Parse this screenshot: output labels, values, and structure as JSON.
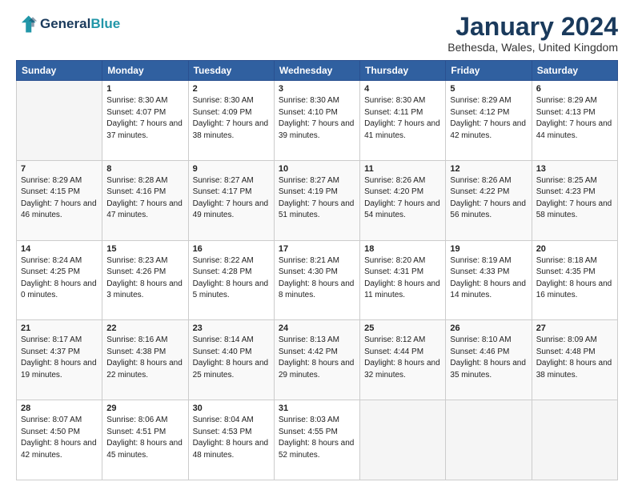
{
  "header": {
    "logo_general": "General",
    "logo_blue": "Blue",
    "month": "January 2024",
    "location": "Bethesda, Wales, United Kingdom"
  },
  "days_of_week": [
    "Sunday",
    "Monday",
    "Tuesday",
    "Wednesday",
    "Thursday",
    "Friday",
    "Saturday"
  ],
  "weeks": [
    [
      {
        "day": "",
        "sunrise": "",
        "sunset": "",
        "daylight": ""
      },
      {
        "day": "1",
        "sunrise": "Sunrise: 8:30 AM",
        "sunset": "Sunset: 4:07 PM",
        "daylight": "Daylight: 7 hours and 37 minutes."
      },
      {
        "day": "2",
        "sunrise": "Sunrise: 8:30 AM",
        "sunset": "Sunset: 4:09 PM",
        "daylight": "Daylight: 7 hours and 38 minutes."
      },
      {
        "day": "3",
        "sunrise": "Sunrise: 8:30 AM",
        "sunset": "Sunset: 4:10 PM",
        "daylight": "Daylight: 7 hours and 39 minutes."
      },
      {
        "day": "4",
        "sunrise": "Sunrise: 8:30 AM",
        "sunset": "Sunset: 4:11 PM",
        "daylight": "Daylight: 7 hours and 41 minutes."
      },
      {
        "day": "5",
        "sunrise": "Sunrise: 8:29 AM",
        "sunset": "Sunset: 4:12 PM",
        "daylight": "Daylight: 7 hours and 42 minutes."
      },
      {
        "day": "6",
        "sunrise": "Sunrise: 8:29 AM",
        "sunset": "Sunset: 4:13 PM",
        "daylight": "Daylight: 7 hours and 44 minutes."
      }
    ],
    [
      {
        "day": "7",
        "sunrise": "Sunrise: 8:29 AM",
        "sunset": "Sunset: 4:15 PM",
        "daylight": "Daylight: 7 hours and 46 minutes."
      },
      {
        "day": "8",
        "sunrise": "Sunrise: 8:28 AM",
        "sunset": "Sunset: 4:16 PM",
        "daylight": "Daylight: 7 hours and 47 minutes."
      },
      {
        "day": "9",
        "sunrise": "Sunrise: 8:27 AM",
        "sunset": "Sunset: 4:17 PM",
        "daylight": "Daylight: 7 hours and 49 minutes."
      },
      {
        "day": "10",
        "sunrise": "Sunrise: 8:27 AM",
        "sunset": "Sunset: 4:19 PM",
        "daylight": "Daylight: 7 hours and 51 minutes."
      },
      {
        "day": "11",
        "sunrise": "Sunrise: 8:26 AM",
        "sunset": "Sunset: 4:20 PM",
        "daylight": "Daylight: 7 hours and 54 minutes."
      },
      {
        "day": "12",
        "sunrise": "Sunrise: 8:26 AM",
        "sunset": "Sunset: 4:22 PM",
        "daylight": "Daylight: 7 hours and 56 minutes."
      },
      {
        "day": "13",
        "sunrise": "Sunrise: 8:25 AM",
        "sunset": "Sunset: 4:23 PM",
        "daylight": "Daylight: 7 hours and 58 minutes."
      }
    ],
    [
      {
        "day": "14",
        "sunrise": "Sunrise: 8:24 AM",
        "sunset": "Sunset: 4:25 PM",
        "daylight": "Daylight: 8 hours and 0 minutes."
      },
      {
        "day": "15",
        "sunrise": "Sunrise: 8:23 AM",
        "sunset": "Sunset: 4:26 PM",
        "daylight": "Daylight: 8 hours and 3 minutes."
      },
      {
        "day": "16",
        "sunrise": "Sunrise: 8:22 AM",
        "sunset": "Sunset: 4:28 PM",
        "daylight": "Daylight: 8 hours and 5 minutes."
      },
      {
        "day": "17",
        "sunrise": "Sunrise: 8:21 AM",
        "sunset": "Sunset: 4:30 PM",
        "daylight": "Daylight: 8 hours and 8 minutes."
      },
      {
        "day": "18",
        "sunrise": "Sunrise: 8:20 AM",
        "sunset": "Sunset: 4:31 PM",
        "daylight": "Daylight: 8 hours and 11 minutes."
      },
      {
        "day": "19",
        "sunrise": "Sunrise: 8:19 AM",
        "sunset": "Sunset: 4:33 PM",
        "daylight": "Daylight: 8 hours and 14 minutes."
      },
      {
        "day": "20",
        "sunrise": "Sunrise: 8:18 AM",
        "sunset": "Sunset: 4:35 PM",
        "daylight": "Daylight: 8 hours and 16 minutes."
      }
    ],
    [
      {
        "day": "21",
        "sunrise": "Sunrise: 8:17 AM",
        "sunset": "Sunset: 4:37 PM",
        "daylight": "Daylight: 8 hours and 19 minutes."
      },
      {
        "day": "22",
        "sunrise": "Sunrise: 8:16 AM",
        "sunset": "Sunset: 4:38 PM",
        "daylight": "Daylight: 8 hours and 22 minutes."
      },
      {
        "day": "23",
        "sunrise": "Sunrise: 8:14 AM",
        "sunset": "Sunset: 4:40 PM",
        "daylight": "Daylight: 8 hours and 25 minutes."
      },
      {
        "day": "24",
        "sunrise": "Sunrise: 8:13 AM",
        "sunset": "Sunset: 4:42 PM",
        "daylight": "Daylight: 8 hours and 29 minutes."
      },
      {
        "day": "25",
        "sunrise": "Sunrise: 8:12 AM",
        "sunset": "Sunset: 4:44 PM",
        "daylight": "Daylight: 8 hours and 32 minutes."
      },
      {
        "day": "26",
        "sunrise": "Sunrise: 8:10 AM",
        "sunset": "Sunset: 4:46 PM",
        "daylight": "Daylight: 8 hours and 35 minutes."
      },
      {
        "day": "27",
        "sunrise": "Sunrise: 8:09 AM",
        "sunset": "Sunset: 4:48 PM",
        "daylight": "Daylight: 8 hours and 38 minutes."
      }
    ],
    [
      {
        "day": "28",
        "sunrise": "Sunrise: 8:07 AM",
        "sunset": "Sunset: 4:50 PM",
        "daylight": "Daylight: 8 hours and 42 minutes."
      },
      {
        "day": "29",
        "sunrise": "Sunrise: 8:06 AM",
        "sunset": "Sunset: 4:51 PM",
        "daylight": "Daylight: 8 hours and 45 minutes."
      },
      {
        "day": "30",
        "sunrise": "Sunrise: 8:04 AM",
        "sunset": "Sunset: 4:53 PM",
        "daylight": "Daylight: 8 hours and 48 minutes."
      },
      {
        "day": "31",
        "sunrise": "Sunrise: 8:03 AM",
        "sunset": "Sunset: 4:55 PM",
        "daylight": "Daylight: 8 hours and 52 minutes."
      },
      {
        "day": "",
        "sunrise": "",
        "sunset": "",
        "daylight": ""
      },
      {
        "day": "",
        "sunrise": "",
        "sunset": "",
        "daylight": ""
      },
      {
        "day": "",
        "sunrise": "",
        "sunset": "",
        "daylight": ""
      }
    ]
  ]
}
